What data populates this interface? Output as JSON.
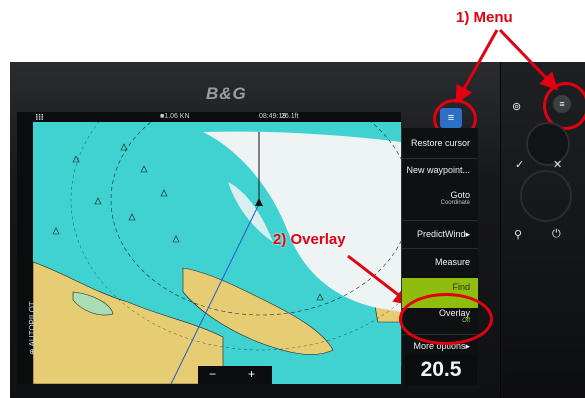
{
  "annotations": {
    "menu_label": "1)  Menu",
    "overlay_label": "2) Overlay"
  },
  "device": {
    "brand": "B&G"
  },
  "status_bar": {
    "speed": "■1.06 KN",
    "time": "08:49:19",
    "depth": "26.1ft"
  },
  "side_toolbar": {
    "autopilot_label": "AUTOPILOT"
  },
  "menu": {
    "items": [
      {
        "label": "Restore cursor"
      },
      {
        "label": "New waypoint..."
      },
      {
        "label": "Goto",
        "sub": "Coordinate"
      },
      {
        "label": "PredictWind▸"
      },
      {
        "label": "Measure"
      },
      {
        "label": "Find"
      },
      {
        "label": "Overlay",
        "sub": "Off"
      },
      {
        "label": "More options▸"
      }
    ]
  },
  "readout": {
    "value": "20.5"
  },
  "zoom": {
    "minus": "−",
    "plus": "+"
  },
  "colors": {
    "annotation_red": "#e3000f",
    "find_highlight": "#8fbd0e",
    "sea": "#3fd2d0",
    "land": "#e6cd73"
  },
  "icons": {
    "menu": "hamburger-icon",
    "apps": "apps-grid-icon",
    "waypoint": "checkmark-icon",
    "close": "x-icon",
    "power": "power-icon",
    "location": "pin-icon"
  }
}
